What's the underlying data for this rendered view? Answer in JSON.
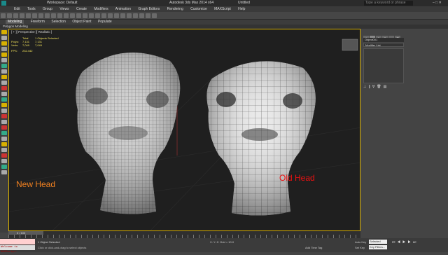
{
  "titlebar": {
    "workspace": "Workspace: Default",
    "app_title": "Autodesk 3ds Max 2014 x64",
    "file": "Untitled",
    "search_placeholder": "Type a keyword or phrase"
  },
  "menu": [
    "Edit",
    "Tools",
    "Group",
    "Views",
    "Create",
    "Modifiers",
    "Animation",
    "Graph Editors",
    "Rendering",
    "Customize",
    "MAXScript",
    "Help"
  ],
  "ribbon": {
    "tabs": [
      "Modeling",
      "Freeform",
      "Selection",
      "Object Paint",
      "Populate"
    ],
    "subtitle": "Polygon Modeling"
  },
  "viewport": {
    "label": "[ + ][ Perspective ][ Realistic ]",
    "stats_header": [
      "Total",
      "1 Objects Selected"
    ],
    "stats_rows": [
      {
        "label": "Polys:",
        "total": "7,131",
        "selected": "7,131"
      },
      {
        "label": "Verts:",
        "total": "7,049",
        "selected": "7,049"
      }
    ],
    "fps_label": "FPS:",
    "fps_value": "232.442",
    "label_new": "New Head",
    "label_old": "Old Head"
  },
  "command_panel": {
    "object_name": "Object001",
    "modifier_list": "Modifier List"
  },
  "timeline": {
    "frame_readout": "0 / 100"
  },
  "status": {
    "maxscript_text": "Welcome to MAXScript.",
    "selection": "1 Object Selected",
    "hint": "Click or click-and-drag to select objects",
    "coords": "X:  Y:  Z:  Grid = 10.0",
    "autokey": "Auto Key",
    "autokey_value": "Selected",
    "setkey": "Set Key",
    "setkey_value": "Key Filters...",
    "add_time_tag": "Add Time Tag"
  },
  "colors": {
    "viewport_border": "#d8b000",
    "new_label": "#f08020",
    "old_label": "#ee1111"
  }
}
